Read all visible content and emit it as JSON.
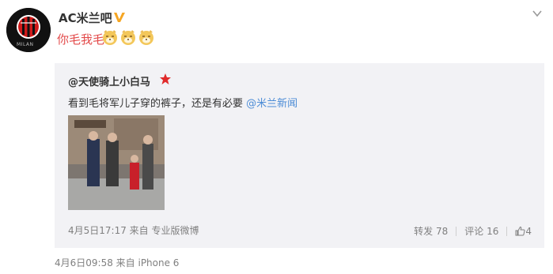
{
  "author": {
    "name": "AC米兰吧",
    "avatar_text": "MILAN"
  },
  "post": {
    "text": "你毛我毛"
  },
  "repost": {
    "author": "@天使骑上小白马",
    "text": "看到毛将军儿子穿的裤子，还是有必要 ",
    "mention": "@米兰新闻",
    "meta": "4月5日17:17 来自 专业版微博",
    "repost_label": "转发 78",
    "comment_label": "评论 16",
    "like_count": "4"
  },
  "footer": {
    "meta": "4月6日09:58 来自 iPhone 6"
  },
  "colors": {
    "accent_red": "#e34a4a",
    "mention_blue": "#4c8cd6",
    "panel_bg": "#f2f2f5",
    "meta_gray": "#808080"
  },
  "icons": [
    "verified-v-icon",
    "chevron-down-icon",
    "dog-emoji-icon",
    "star-badge-icon",
    "like-thumb-icon"
  ]
}
